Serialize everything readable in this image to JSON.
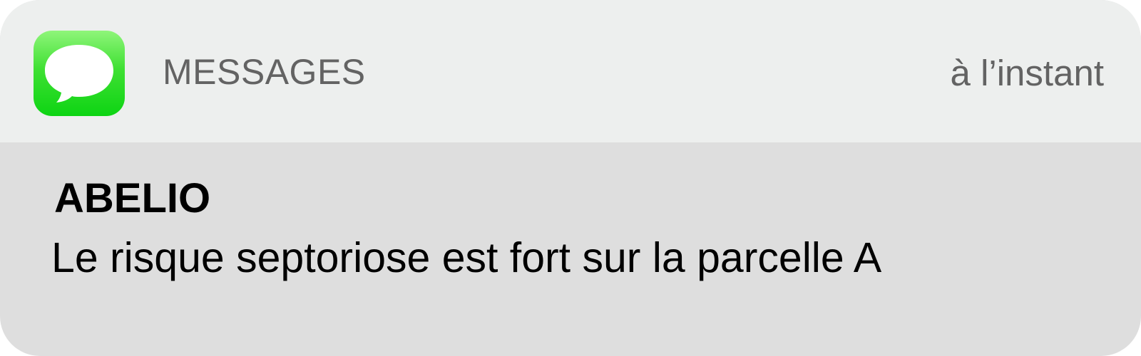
{
  "notification": {
    "app": {
      "icon": "speech-bubble-icon",
      "name": "MESSAGES",
      "timestamp": "à l’instant",
      "icon_colors": {
        "top": "#8ff57a",
        "bottom": "#0dd413",
        "bubble": "#ffffff"
      }
    },
    "sender": "ABELIO",
    "message": "Le risque septoriose est fort sur la parcelle A",
    "colors": {
      "header_background": "#edefee",
      "body_background": "#dedede",
      "secondary_text": "#636363",
      "primary_text": "#000000"
    }
  }
}
